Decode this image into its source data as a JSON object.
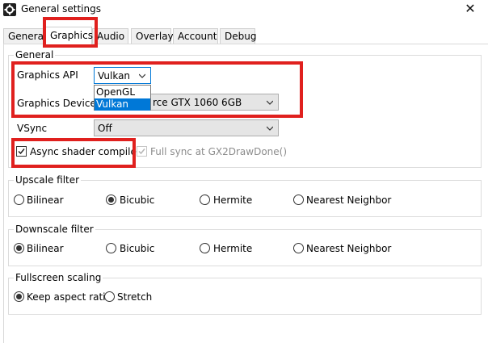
{
  "window": {
    "title": "General settings",
    "close_glyph": "✕",
    "app_icon": "gear-icon"
  },
  "tabs": [
    {
      "label": "General",
      "active": false
    },
    {
      "label": "Graphics",
      "active": true
    },
    {
      "label": "Audio",
      "active": false
    },
    {
      "label": "Overlay",
      "active": false
    },
    {
      "label": "Account",
      "active": false
    },
    {
      "label": "Debug",
      "active": false
    }
  ],
  "general": {
    "title": "General",
    "graphics_api": {
      "label": "Graphics API",
      "value": "Vulkan",
      "options": [
        "OpenGL",
        "Vulkan"
      ],
      "selected_option": "Vulkan"
    },
    "graphics_device": {
      "label": "Graphics Device",
      "value_visible": "rce GTX 1060 6GB"
    },
    "vsync": {
      "label": "VSync",
      "value": "Off"
    },
    "async_shader": {
      "label": "Async shader compile",
      "checked": true
    },
    "full_sync": {
      "label": "Full sync at GX2DrawDone()",
      "checked": true,
      "disabled": true
    }
  },
  "upscale": {
    "title": "Upscale filter",
    "options": [
      "Bilinear",
      "Bicubic",
      "Hermite",
      "Nearest Neighbor"
    ],
    "selected": "Bicubic"
  },
  "downscale": {
    "title": "Downscale filter",
    "options": [
      "Bilinear",
      "Bicubic",
      "Hermite",
      "Nearest Neighbor"
    ],
    "selected": "Bilinear"
  },
  "fullscreen": {
    "title": "Fullscreen scaling",
    "options": [
      "Keep aspect ratio",
      "Stretch"
    ],
    "selected": "Keep aspect ratio"
  },
  "colors": {
    "highlight": "#e0201e",
    "selection": "#0078d7"
  }
}
